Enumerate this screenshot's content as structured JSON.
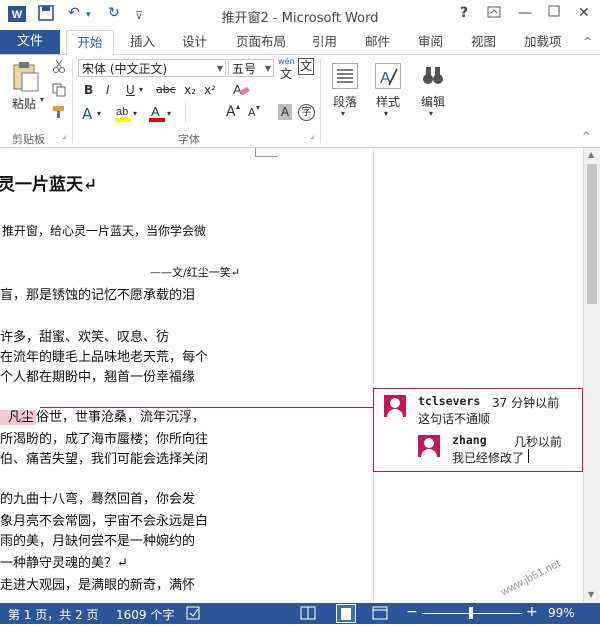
{
  "window": {
    "title": "推开窗2 - Microsoft Word"
  },
  "tabs": [
    "文件",
    "开始",
    "插入",
    "设计",
    "页面布局",
    "引用",
    "邮件",
    "审阅",
    "视图",
    "加载项"
  ],
  "ribbon": {
    "paste_label": "粘贴",
    "font_name": "宋体 (中文正文)",
    "font_size": "五号",
    "wen_small": "wén",
    "wen_big": "文",
    "bold": "B",
    "italic": "I",
    "underline": "U",
    "strike": "abc",
    "sub": "x₂",
    "sup": "x²",
    "font_color_a": "A",
    "grow": "A",
    "shrink": "A",
    "aa": "Aa",
    "para_label": "段落",
    "style_label": "样式",
    "edit_label": "编辑",
    "group_clipboard": "剪贴板",
    "group_font": "字体"
  },
  "document": {
    "lines": [
      "灵一片蓝天↵",
      "推开窗，给心灵一片蓝天，当你学会微",
      "——文/红尘一笑↵",
      "盲，那是锈蚀的记忆不愿承载的泪",
      "许多，甜蜜、欢笑、叹息、彷",
      "在流年的睫毛上品味地老天荒，每个",
      "个人都在期盼中，翘首一份幸福缘",
      "凡尘",
      "俗世，世事沧桑，流年沉浮，",
      "所渴盼的，成了海市蜃楼；你所向往",
      "伯、痛苦失望，我们可能会选择关闭",
      "的九曲十八弯，蓦然回首，你会发",
      "象月亮不会常圆，宇宙不会永远是白",
      "雨的美，月缺何尝不是一种婉约的",
      "一种静守灵魂的美？↵",
      "走进大观园，是满眼的新奇，满怀"
    ]
  },
  "comments": [
    {
      "author": "tclsevers",
      "time": "37 分钟以前",
      "text": "这句话不通顺"
    },
    {
      "author": "zhang",
      "time": "几秒以前",
      "text": "我已经修改了"
    }
  ],
  "statusbar": {
    "page": "第 1 页，共 2 页",
    "words": "1609 个字",
    "zoom": "99%"
  },
  "watermark": "www.jb51.net"
}
